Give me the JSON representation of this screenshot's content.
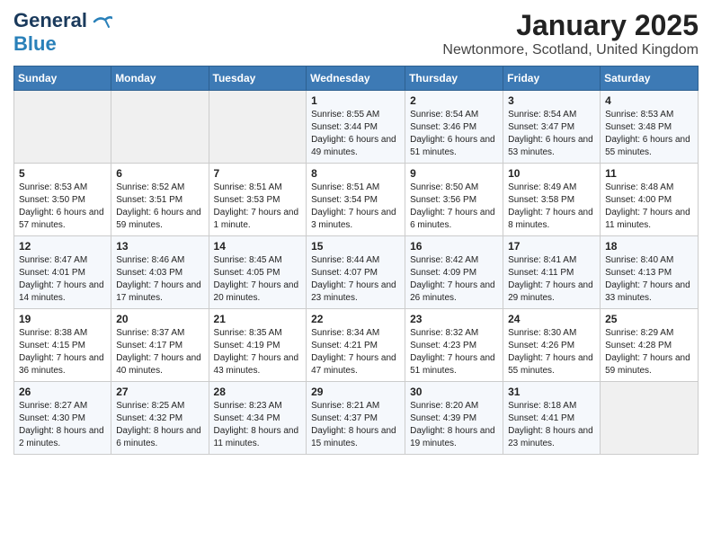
{
  "logo": {
    "line1": "General",
    "line2": "Blue"
  },
  "title": "January 2025",
  "subtitle": "Newtonmore, Scotland, United Kingdom",
  "days_of_week": [
    "Sunday",
    "Monday",
    "Tuesday",
    "Wednesday",
    "Thursday",
    "Friday",
    "Saturday"
  ],
  "weeks": [
    [
      {
        "day": "",
        "info": ""
      },
      {
        "day": "",
        "info": ""
      },
      {
        "day": "",
        "info": ""
      },
      {
        "day": "1",
        "info": "Sunrise: 8:55 AM\nSunset: 3:44 PM\nDaylight: 6 hours and 49 minutes."
      },
      {
        "day": "2",
        "info": "Sunrise: 8:54 AM\nSunset: 3:46 PM\nDaylight: 6 hours and 51 minutes."
      },
      {
        "day": "3",
        "info": "Sunrise: 8:54 AM\nSunset: 3:47 PM\nDaylight: 6 hours and 53 minutes."
      },
      {
        "day": "4",
        "info": "Sunrise: 8:53 AM\nSunset: 3:48 PM\nDaylight: 6 hours and 55 minutes."
      }
    ],
    [
      {
        "day": "5",
        "info": "Sunrise: 8:53 AM\nSunset: 3:50 PM\nDaylight: 6 hours and 57 minutes."
      },
      {
        "day": "6",
        "info": "Sunrise: 8:52 AM\nSunset: 3:51 PM\nDaylight: 6 hours and 59 minutes."
      },
      {
        "day": "7",
        "info": "Sunrise: 8:51 AM\nSunset: 3:53 PM\nDaylight: 7 hours and 1 minute."
      },
      {
        "day": "8",
        "info": "Sunrise: 8:51 AM\nSunset: 3:54 PM\nDaylight: 7 hours and 3 minutes."
      },
      {
        "day": "9",
        "info": "Sunrise: 8:50 AM\nSunset: 3:56 PM\nDaylight: 7 hours and 6 minutes."
      },
      {
        "day": "10",
        "info": "Sunrise: 8:49 AM\nSunset: 3:58 PM\nDaylight: 7 hours and 8 minutes."
      },
      {
        "day": "11",
        "info": "Sunrise: 8:48 AM\nSunset: 4:00 PM\nDaylight: 7 hours and 11 minutes."
      }
    ],
    [
      {
        "day": "12",
        "info": "Sunrise: 8:47 AM\nSunset: 4:01 PM\nDaylight: 7 hours and 14 minutes."
      },
      {
        "day": "13",
        "info": "Sunrise: 8:46 AM\nSunset: 4:03 PM\nDaylight: 7 hours and 17 minutes."
      },
      {
        "day": "14",
        "info": "Sunrise: 8:45 AM\nSunset: 4:05 PM\nDaylight: 7 hours and 20 minutes."
      },
      {
        "day": "15",
        "info": "Sunrise: 8:44 AM\nSunset: 4:07 PM\nDaylight: 7 hours and 23 minutes."
      },
      {
        "day": "16",
        "info": "Sunrise: 8:42 AM\nSunset: 4:09 PM\nDaylight: 7 hours and 26 minutes."
      },
      {
        "day": "17",
        "info": "Sunrise: 8:41 AM\nSunset: 4:11 PM\nDaylight: 7 hours and 29 minutes."
      },
      {
        "day": "18",
        "info": "Sunrise: 8:40 AM\nSunset: 4:13 PM\nDaylight: 7 hours and 33 minutes."
      }
    ],
    [
      {
        "day": "19",
        "info": "Sunrise: 8:38 AM\nSunset: 4:15 PM\nDaylight: 7 hours and 36 minutes."
      },
      {
        "day": "20",
        "info": "Sunrise: 8:37 AM\nSunset: 4:17 PM\nDaylight: 7 hours and 40 minutes."
      },
      {
        "day": "21",
        "info": "Sunrise: 8:35 AM\nSunset: 4:19 PM\nDaylight: 7 hours and 43 minutes."
      },
      {
        "day": "22",
        "info": "Sunrise: 8:34 AM\nSunset: 4:21 PM\nDaylight: 7 hours and 47 minutes."
      },
      {
        "day": "23",
        "info": "Sunrise: 8:32 AM\nSunset: 4:23 PM\nDaylight: 7 hours and 51 minutes."
      },
      {
        "day": "24",
        "info": "Sunrise: 8:30 AM\nSunset: 4:26 PM\nDaylight: 7 hours and 55 minutes."
      },
      {
        "day": "25",
        "info": "Sunrise: 8:29 AM\nSunset: 4:28 PM\nDaylight: 7 hours and 59 minutes."
      }
    ],
    [
      {
        "day": "26",
        "info": "Sunrise: 8:27 AM\nSunset: 4:30 PM\nDaylight: 8 hours and 2 minutes."
      },
      {
        "day": "27",
        "info": "Sunrise: 8:25 AM\nSunset: 4:32 PM\nDaylight: 8 hours and 6 minutes."
      },
      {
        "day": "28",
        "info": "Sunrise: 8:23 AM\nSunset: 4:34 PM\nDaylight: 8 hours and 11 minutes."
      },
      {
        "day": "29",
        "info": "Sunrise: 8:21 AM\nSunset: 4:37 PM\nDaylight: 8 hours and 15 minutes."
      },
      {
        "day": "30",
        "info": "Sunrise: 8:20 AM\nSunset: 4:39 PM\nDaylight: 8 hours and 19 minutes."
      },
      {
        "day": "31",
        "info": "Sunrise: 8:18 AM\nSunset: 4:41 PM\nDaylight: 8 hours and 23 minutes."
      },
      {
        "day": "",
        "info": ""
      }
    ]
  ]
}
